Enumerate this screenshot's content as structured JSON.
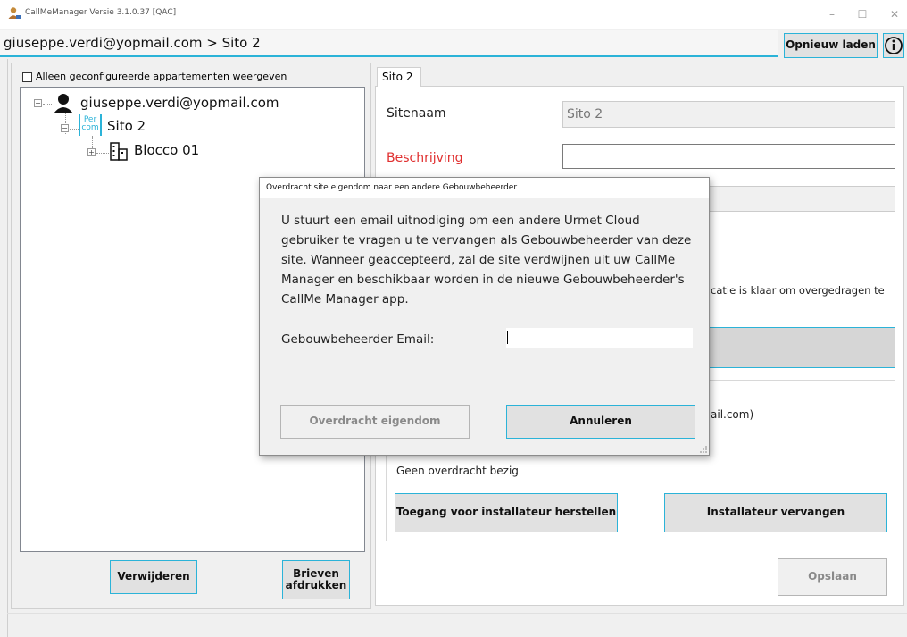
{
  "window": {
    "title": "CallMeManager Versie 3.1.0.37 [QAC]",
    "minimize": "–",
    "maximize": "☐",
    "close": "✕"
  },
  "breadcrumb": "giuseppe.verdi@yopmail.com > Sito 2",
  "toolbar": {
    "reload_label": "Opnieuw laden",
    "info_icon": "info-icon"
  },
  "left": {
    "filter_label": "Alleen geconfigureerde appartementen weergeven",
    "filter_checked": false,
    "tree": {
      "user": "giuseppe.verdi@yopmail.com",
      "site": "Sito 2",
      "site_logo": "Per com",
      "block": "Blocco 01"
    },
    "delete_label": "Verwijderen",
    "print_label_line1": "Brieven",
    "print_label_line2": "afdrukken"
  },
  "right": {
    "tab_label": "Sito 2",
    "site_name_label": "Sitenaam",
    "site_name_value": "Sito 2",
    "description_label": "Beschrijving",
    "description_value": "",
    "partial_status_text": "catie is klaar om overgedragen te",
    "partial_email_text": "ail.com)",
    "no_transfer_text": "Geen overdracht bezig",
    "restore_installer_label": "Toegang voor installateur herstellen",
    "replace_installer_label": "Installateur vervangen",
    "save_label": "Opslaan"
  },
  "dialog": {
    "title": "Overdracht site eigendom naar een andere Gebouwbeheerder",
    "message": "U stuurt een email uitnodiging om een andere Urmet Cloud gebruiker te vragen u te vervangen als Gebouwbeheerder van deze site. Wanneer geaccepteerd, zal de site verdwijnen uit uw CallMe Manager en beschikbaar worden in de nieuwe Gebouwbeheerder's CallMe Manager app.",
    "email_label": "Gebouwbeheerder Email:",
    "email_value": "",
    "transfer_label": "Overdracht eigendom",
    "cancel_label": "Annuleren"
  },
  "colors": {
    "accent": "#2bb3d8",
    "required_label": "#e03030"
  }
}
